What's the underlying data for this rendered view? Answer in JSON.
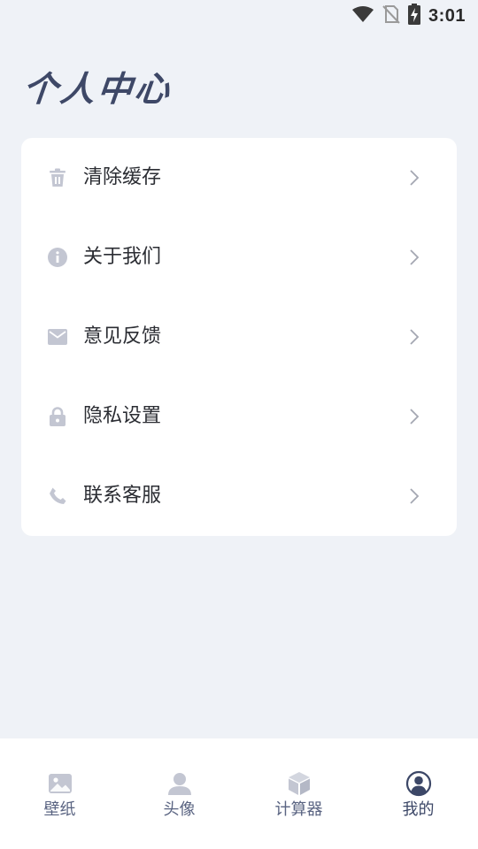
{
  "status_bar": {
    "time": "3:01",
    "icons": [
      "wifi-icon",
      "no-sim-icon",
      "battery-charging-icon"
    ]
  },
  "page": {
    "title": "个人中心"
  },
  "menu": {
    "items": [
      {
        "label": "清除缓存",
        "icon": "trash-icon"
      },
      {
        "label": "关于我们",
        "icon": "info-icon"
      },
      {
        "label": "意见反馈",
        "icon": "mail-icon"
      },
      {
        "label": "隐私设置",
        "icon": "lock-icon"
      },
      {
        "label": "联系客服",
        "icon": "phone-icon"
      }
    ]
  },
  "bottom_nav": {
    "active_index": 3,
    "items": [
      {
        "label": "壁纸",
        "icon": "image-icon"
      },
      {
        "label": "头像",
        "icon": "person-icon"
      },
      {
        "label": "计算器",
        "icon": "cube-icon"
      },
      {
        "label": "我的",
        "icon": "account-circle-icon"
      }
    ]
  },
  "colors": {
    "background": "#eff2f7",
    "card": "#ffffff",
    "icon_grey": "#c3c6d2",
    "title_navy": "#3e4867",
    "nav_label": "#5a6482",
    "nav_active_icon": "#3c4767"
  }
}
